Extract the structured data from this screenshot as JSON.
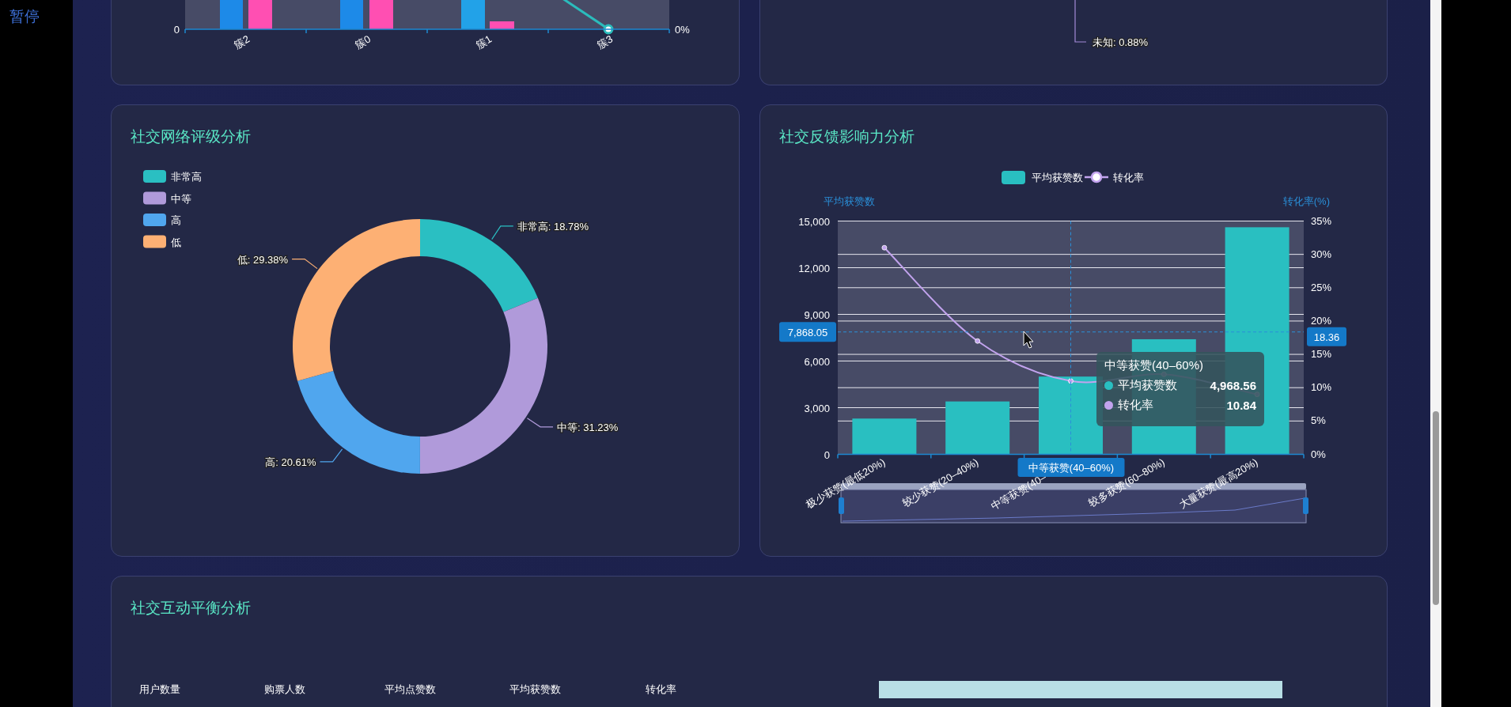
{
  "sidebar": {
    "pause_label": "暂停"
  },
  "cluster_card": {
    "x_labels": [
      "簇2",
      "簇0",
      "簇1",
      "簇3"
    ],
    "left_tick": "0",
    "right_tick": "0%"
  },
  "category_card": {
    "slice_label": "未知: 0.88%"
  },
  "rating_card": {
    "title": "社交网络评级分析",
    "legend": [
      {
        "color": "#2abfc2"
      },
      {
        "color": "#b09ada"
      },
      {
        "color": "#50a6ee"
      },
      {
        "color": "#fdb074"
      }
    ],
    "chart_data": {
      "type": "donut",
      "categories": [
        "非常高",
        "中等",
        "高",
        "低"
      ],
      "values": [
        18.78,
        31.23,
        20.61,
        29.38
      ],
      "data_labels": true,
      "value_labels": [
        "非常高: 18.78%",
        "中等: 31.23%",
        "高: 20.61%",
        "低: 29.38%"
      ]
    }
  },
  "feedback_card": {
    "title": "社交反馈影响力分析",
    "left_axis_name": "平均获赞数",
    "right_axis_name": "转化率(%)",
    "right_ticks": [
      "35%",
      "30%",
      "25%",
      "20%",
      "15%",
      "10%",
      "5%",
      "0%"
    ],
    "legend": [
      {
        "kind": "bar"
      },
      {
        "kind": "line"
      }
    ],
    "right_pointer_label": "18.36",
    "chart_data": {
      "type": "bar",
      "grid": true,
      "categories": [
        "极少获赞(最低20%)",
        "较少获赞(20–40%)",
        "中等获赞(40–",
        "较多获赞(60–80%)",
        "大量获赞(最高20%)"
      ],
      "series": [
        {
          "name": "平均获赞数",
          "color": "#29bfc1",
          "values": [
            2300,
            3400,
            5000,
            7400,
            14600
          ]
        },
        {
          "name": "转化率",
          "color": "#c2a3ee",
          "values": [
            31,
            17,
            11,
            12,
            9
          ]
        }
      ],
      "ylim": [
        0,
        15000
      ],
      "yticks": [
        {
          "value": 0,
          "label": "0"
        },
        {
          "value": 3000,
          "label": "3,000"
        },
        {
          "value": 6000,
          "label": "6,000"
        },
        {
          "value": 9000,
          "label": "9,000"
        },
        {
          "value": 12000,
          "label": "12,000"
        },
        {
          "value": 15000,
          "label": "15,000"
        }
      ],
      "ref_lines": [
        {
          "axis": "x",
          "value": "中等获赞(40–",
          "label": "中等获赞(40–60%)"
        },
        {
          "axis": "y",
          "value": 7868.05,
          "label": "7,868.05"
        }
      ]
    },
    "tooltip": {
      "title": "中等获赞(40–60%)",
      "rows": [
        {
          "name": "平均获赞数",
          "value": "4,968.56"
        },
        {
          "name": "转化率",
          "value": "10.84"
        }
      ]
    }
  },
  "balance_card": {
    "title": "社交互动平衡分析",
    "columns": [
      "用户数量",
      "购票人数",
      "平均点赞数",
      "平均获赞数",
      "转化率"
    ]
  }
}
